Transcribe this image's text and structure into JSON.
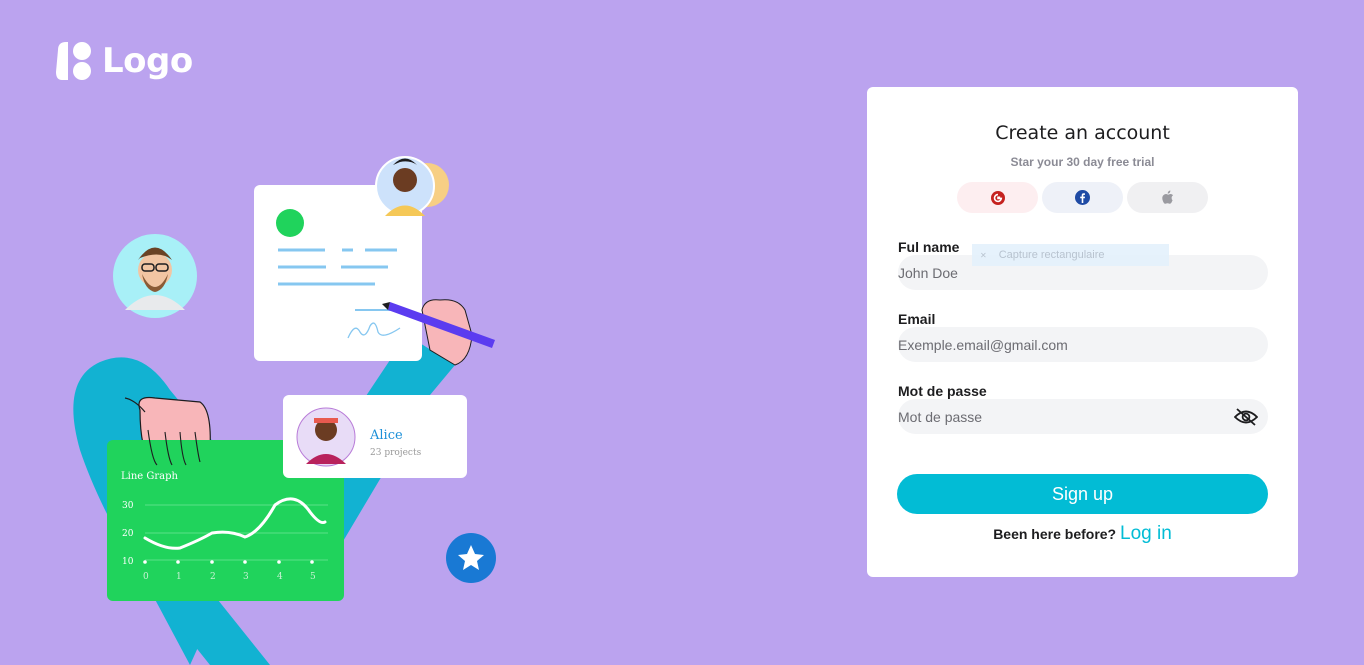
{
  "logo": {
    "text": "Logo"
  },
  "illustration": {
    "profile_name": "Alice",
    "profile_projects": "23 projects",
    "graph_title": "Line Graph",
    "graph_y_ticks": [
      "30",
      "20",
      "10"
    ],
    "graph_x_ticks": [
      "0",
      "1",
      "2",
      "3",
      "4",
      "5"
    ]
  },
  "form": {
    "title": "Create an account",
    "subtitle": "Star your 30 day free trial",
    "social": [
      {
        "name": "google-icon",
        "glyph": "G",
        "color": "#c5221f"
      },
      {
        "name": "facebook-icon",
        "glyph": "f",
        "color": "#1f4ba5"
      },
      {
        "name": "apple-icon",
        "glyph": "",
        "color": "#9a9aa0"
      }
    ],
    "fullname": {
      "label": "Ful name",
      "placeholder": "John Doe"
    },
    "email": {
      "label": "Email",
      "placeholder": "Exemple.email@gmail.com"
    },
    "password": {
      "label": "Mot de passe",
      "placeholder": "Mot de passe"
    },
    "tooltip": "Capture rectangulaire",
    "submit_label": "Sign up",
    "login_prompt": "Been here before?",
    "login_link": "Log in"
  },
  "colors": {
    "background": "#bba3ef",
    "accent": "#02bcd5",
    "card": "#ffffff"
  }
}
